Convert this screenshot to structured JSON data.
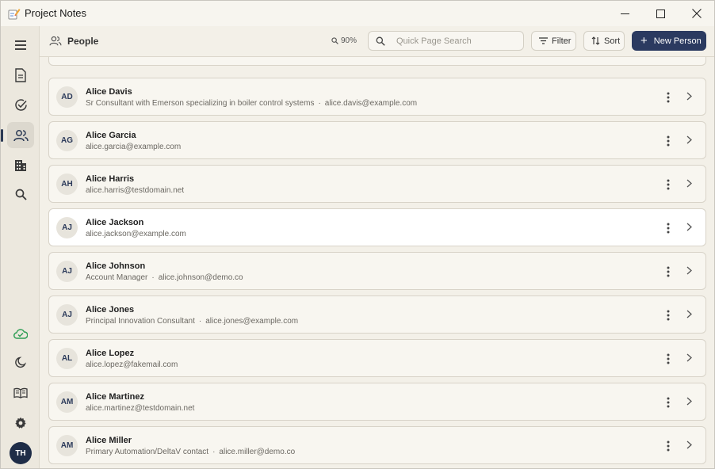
{
  "window": {
    "title": "Project Notes"
  },
  "header": {
    "title": "People",
    "zoom": "90%",
    "search_placeholder": "Quick Page Search",
    "filter_label": "Filter",
    "sort_label": "Sort",
    "new_label": "New Person"
  },
  "rail": {
    "items": [
      "menu-icon",
      "document-icon",
      "check-circle-icon",
      "people-icon",
      "building-icon",
      "search-icon"
    ],
    "bottom": [
      "cloud-sync-icon",
      "moon-icon",
      "book-icon",
      "gear-icon"
    ],
    "user_initials": "TH",
    "sync_color": "#2f9e55",
    "accent": "#2b3a60"
  },
  "people": [
    {
      "initials": "AD",
      "name": "Alice Davis",
      "role": "Sr Consultant with Emerson specializing in boiler control systems",
      "email": "alice.davis@example.com"
    },
    {
      "initials": "AG",
      "name": "Alice Garcia",
      "role": "",
      "email": "alice.garcia@example.com"
    },
    {
      "initials": "AH",
      "name": "Alice Harris",
      "role": "",
      "email": "alice.harris@testdomain.net"
    },
    {
      "initials": "AJ",
      "name": "Alice Jackson",
      "role": "",
      "email": "alice.jackson@example.com"
    },
    {
      "initials": "AJ",
      "name": "Alice Johnson",
      "role": "Account Manager",
      "email": "alice.johnson@demo.co"
    },
    {
      "initials": "AJ",
      "name": "Alice Jones",
      "role": "Principal Innovation Consultant",
      "email": "alice.jones@example.com"
    },
    {
      "initials": "AL",
      "name": "Alice Lopez",
      "role": "",
      "email": "alice.lopez@fakemail.com"
    },
    {
      "initials": "AM",
      "name": "Alice Martinez",
      "role": "",
      "email": "alice.martinez@testdomain.net"
    },
    {
      "initials": "AM",
      "name": "Alice Miller",
      "role": "Primary Automation/DeltaV contact",
      "email": "alice.miller@demo.co"
    }
  ],
  "highlighted_index": 3
}
